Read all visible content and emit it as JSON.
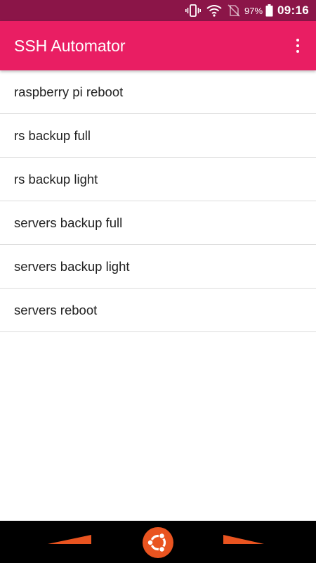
{
  "status_bar": {
    "battery_percent": "97%",
    "time": "09:16",
    "icons": [
      "vibrate-icon",
      "wifi-icon",
      "no-sim-icon",
      "battery-icon"
    ]
  },
  "app_bar": {
    "title": "SSH Automator",
    "menu_icon": "overflow-menu-icon"
  },
  "list": {
    "items": [
      {
        "label": "raspberry pi reboot"
      },
      {
        "label": "rs backup full"
      },
      {
        "label": "rs backup light"
      },
      {
        "label": "servers backup full"
      },
      {
        "label": "servers backup light"
      },
      {
        "label": "servers reboot"
      }
    ]
  },
  "nav_bar": {
    "back_icon": "back-icon",
    "home_icon": "ubuntu-logo-icon",
    "forward_icon": "forward-icon"
  },
  "colors": {
    "status_bar": "#8b1548",
    "app_bar": "#e91e63",
    "nav_accent": "#e95420"
  }
}
